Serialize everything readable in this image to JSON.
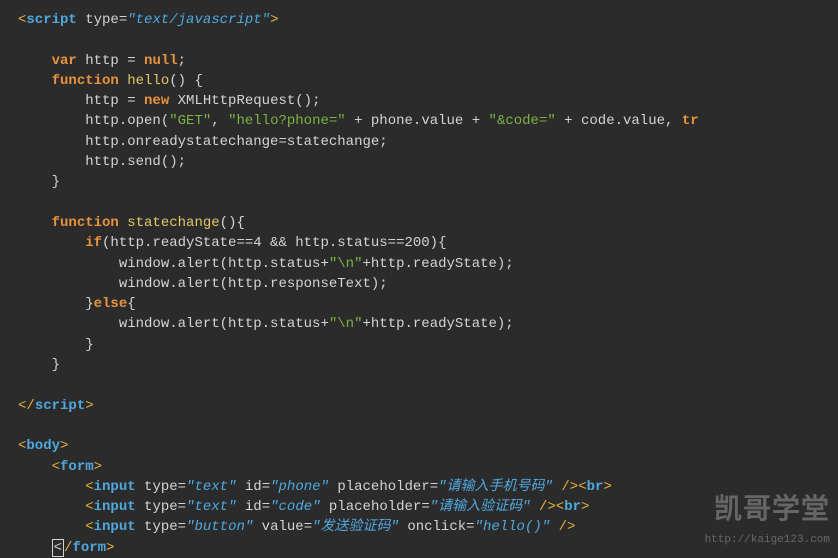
{
  "code": {
    "tokens": {
      "script_open_lt": "<",
      "script_tag": "script",
      "type_attr": " type",
      "eq": "=",
      "type_val": "\"text/javascript\"",
      "gt": ">",
      "var_kw": "var",
      "http_decl": " http = ",
      "null_kw": "null",
      "semi": ";",
      "function_kw": "function",
      "hello_fn": " hello",
      "paren_open": "(",
      "paren_close": ")",
      "space": " ",
      "brace_open": "{",
      "brace_close": "}",
      "http_assign": "http = ",
      "new_kw": "new",
      "xhr": " XMLHttpRequest",
      "empty_parens": "()",
      "http_open": "http.open(",
      "get_str": "\"GET\"",
      "comma_sp": ", ",
      "hello_phone_str": "\"hello?phone=\"",
      "plus": " + ",
      "phone_val": "phone.value",
      "code_str": "\"&code=\"",
      "code_val": "code.value",
      "tr_trunc": "tr",
      "onready": "http.onreadystatechange=statechange;",
      "http_send": "http.send();",
      "statechange_fn": " statechange",
      "if_kw": "if",
      "if_cond": "(http.readyState==4 && http.status==200){",
      "alert1": "window.alert(http.status+",
      "newline_str": "\"\\n\"",
      "alert1_tail": "+http.readyState);",
      "alert2": "window.alert(http.responseText);",
      "else_kw": "else",
      "script_close_lt": "</",
      "body_tag": "body",
      "form_tag": "form",
      "input_tag": "input",
      "id_attr": " id",
      "placeholder_attr": " placeholder",
      "value_attr": " value",
      "onclick_attr": " onclick",
      "text_val": "\"text\"",
      "phone_id": "\"phone\"",
      "code_id": "\"code\"",
      "button_val": "\"button\"",
      "phone_ph": "\"请输入手机号码\"",
      "code_ph": "\"请输入验证码\"",
      "send_val": "\"发送验证码\"",
      "hello_call": "\"hello()\"",
      "self_close": " />",
      "br_tag": "br",
      "cursor_lt": "<"
    }
  },
  "watermark": {
    "main": "凯哥学堂",
    "url": "http://kaige123.com"
  }
}
